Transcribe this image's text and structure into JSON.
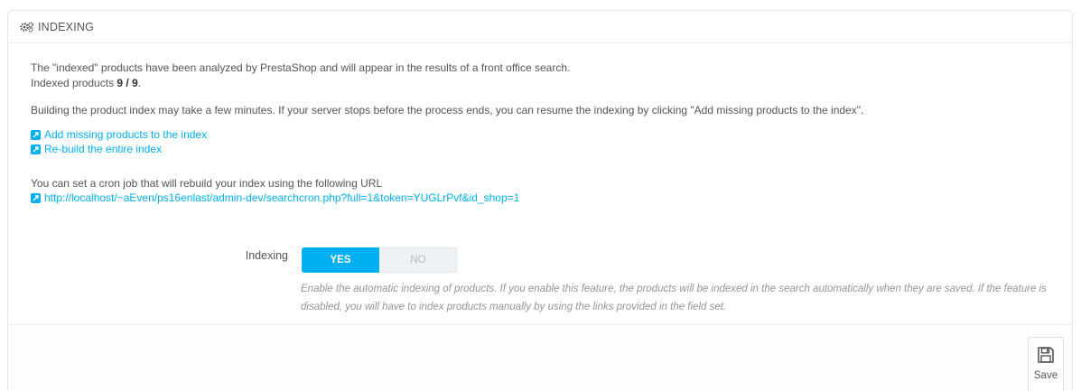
{
  "panel": {
    "title": "INDEXING",
    "title_icon": "cogs-icon"
  },
  "content": {
    "intro_line1": "The \"indexed\" products have been analyzed by PrestaShop and will appear in the results of a front office search.",
    "indexed_prefix": "Indexed products ",
    "indexed_count": "9 / 9",
    "indexed_suffix": ".",
    "build_info": "Building the product index may take a few minutes. If your server stops before the process ends, you can resume the indexing by clicking \"Add missing products to the index\".",
    "cron_info": "You can set a cron job that will rebuild your index using the following URL"
  },
  "links": {
    "add_missing": "Add missing products to the index",
    "rebuild": "Re-build the entire index",
    "cron_url": "http://localhost/~aEven/ps16enlast/admin-dev/searchcron.php?full=1&token=YUGLrPvf&id_shop=1"
  },
  "form": {
    "indexing_label": "Indexing",
    "yes_label": "YES",
    "no_label": "NO",
    "selected": "YES",
    "help": "Enable the automatic indexing of products. If you enable this feature, the products will be indexed in the search automatically when they are saved. If the feature is disabled, you will have to index products manually by using the links provided in the field set."
  },
  "footer": {
    "save_label": "Save",
    "save_icon": "floppy-disk-icon"
  },
  "colors": {
    "accent": "#00aff0",
    "text": "#555555",
    "help_text": "#959595",
    "footer_bg": "#fcfdfe"
  }
}
